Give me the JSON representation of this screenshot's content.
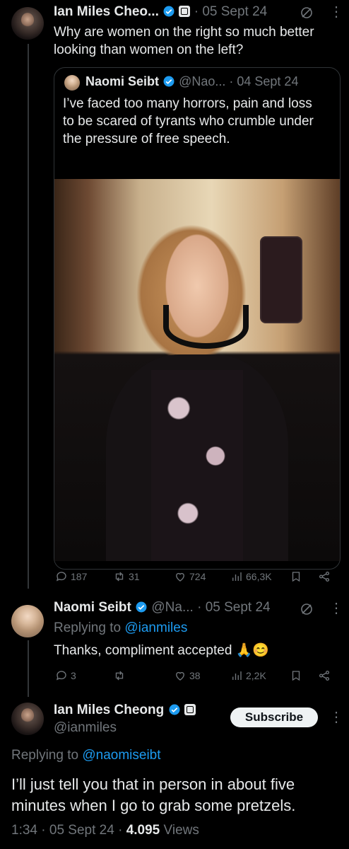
{
  "tweet1": {
    "author": "Ian Miles Cheo...",
    "date": "05 Sept 24",
    "text": "Why are women on the right so much better looking than women on the left?",
    "quote": {
      "author": "Naomi Seibt",
      "handle": "@Nao...",
      "date": "04 Sept 24",
      "text": "I’ve faced too many horrors, pain and loss to be scared of tyrants who crumble under the pressure of free speech."
    },
    "actions": {
      "replies": "187",
      "reposts": "31",
      "likes": "724",
      "views": "66,3K"
    }
  },
  "tweet2": {
    "author": "Naomi Seibt",
    "handle": "@Na...",
    "date": "05 Sept 24",
    "replying_prefix": "Replying to ",
    "replying_to": "@ianmiles",
    "text": "Thanks, compliment accepted 🙏😊",
    "actions": {
      "replies": "3",
      "reposts": "",
      "likes": "38",
      "views": "2,2K"
    }
  },
  "main_tweet": {
    "author": "Ian Miles Cheong",
    "handle": "@ianmiles",
    "subscribe_label": "Subscribe",
    "replying_prefix": "Replying to ",
    "replying_to": "@naomiseibt",
    "text": "I’ll just tell you that in person in about five minutes when I go to grab some pretzels.",
    "time": "1:34",
    "date": "05 Sept 24",
    "views_count": "4.095",
    "views_label": "Views"
  },
  "icons": [
    "verified-badge",
    "grok-icon",
    "more-icon",
    "reply-icon",
    "repost-icon",
    "like-icon",
    "views-icon",
    "bookmark-icon",
    "share-icon"
  ],
  "colors": {
    "accent": "#1d9bf0",
    "muted": "#71767b",
    "text": "#e7e9ea",
    "background": "#000000"
  }
}
